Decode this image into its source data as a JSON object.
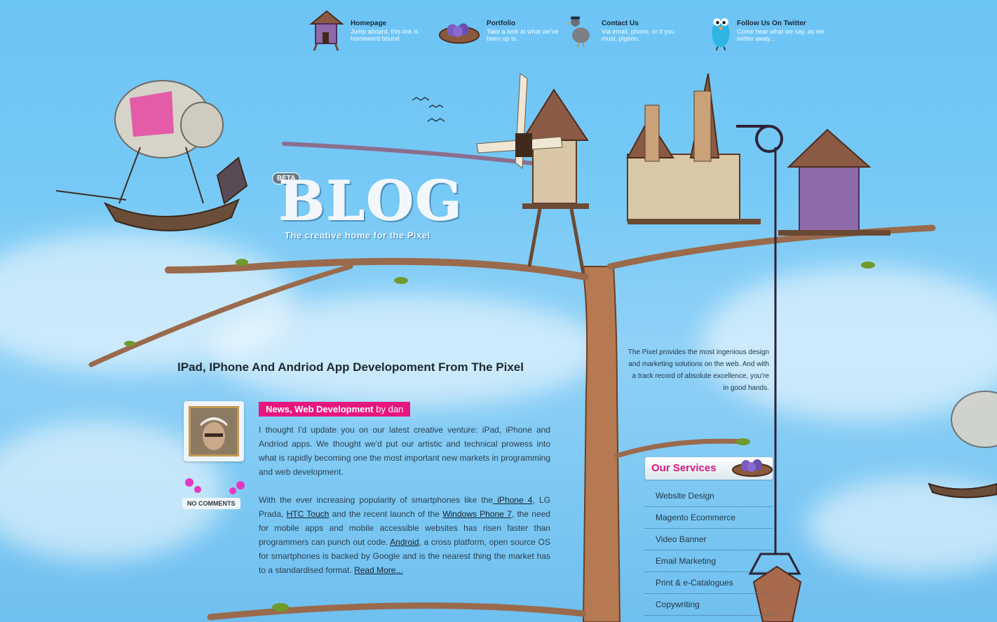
{
  "nav": {
    "items": [
      {
        "title": "Homepage",
        "desc": "Jump aboard, this link is homeward bound.",
        "icon": "treehouse-icon"
      },
      {
        "title": "Portfolio",
        "desc": "Take a look at what we've been up to.",
        "icon": "nest-icon"
      },
      {
        "title": "Contact Us",
        "desc": "Via email, phone, or if you must, pigeon.",
        "icon": "pigeon-icon"
      },
      {
        "title": "Follow Us On Twitter",
        "desc": "Come hear what we say, as we twitter away...",
        "icon": "twitter-bird-icon"
      }
    ]
  },
  "logo": {
    "badge": "BETA",
    "word": "BLOG",
    "tagline": "The creative home for the Pixel"
  },
  "post": {
    "title": "IPad, IPhone And Andriod App Developoment From The Pixel",
    "categories": "News, Web Development",
    "by": " by dan",
    "comments": "NO COMMENTS",
    "p1": "I thought I'd update you on our latest creative venture: iPad, iPhone and Andriod apps. We thought we'd put our artistic and technical prowess into what is rapidly becoming one the most important new markets in programming and web development.",
    "p2_a": "With the ever increasing popularity of smartphones like the",
    "link_iphone": " iPhone 4",
    "p2_b": ", LG Prada, ",
    "link_htc": "HTC Touch",
    "p2_c": " and the recent launch of the ",
    "link_wp7": "Windows Phone 7",
    "p2_d": ", the need for mobile apps and mobile accessible websites has risen faster than programmers can punch out code. ",
    "link_android": "Android",
    "p2_e": ", a cross platform, open source OS for smartphones is backed by Google and is the nearest thing the market has to a standardised format. ",
    "read_more": "Read More..."
  },
  "sidebar": {
    "about": "The Pixel provides the most ingenious design and marketing solutions on the web. And with a track record of absolute excellence, you're in good hands.",
    "services_title": "Our Services",
    "services": [
      "Website Design",
      "Magento Ecommerce",
      "Video Banner",
      "Email Marketing",
      "Print & e-Catalogues",
      "Copywriting"
    ]
  },
  "colors": {
    "accent": "#e6167f",
    "sky": "#6cc4f5"
  }
}
